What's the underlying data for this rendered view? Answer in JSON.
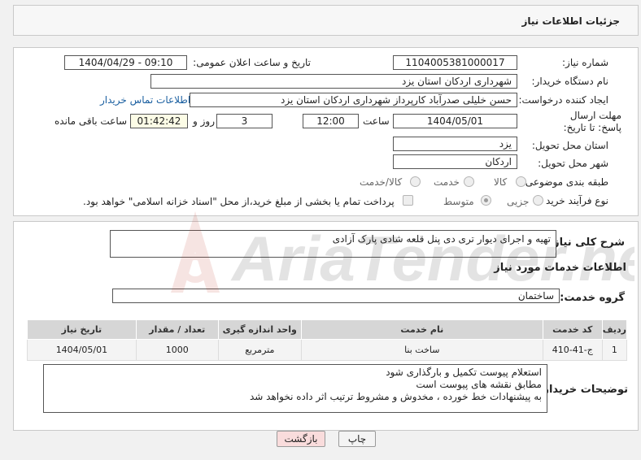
{
  "header": {
    "title": "جزئیات اطلاعات نیاز"
  },
  "form": {
    "need_number_label": "شماره نیاز:",
    "need_number": "1104005381000017",
    "announce_label": "تاریخ و ساعت اعلان عمومی:",
    "announce_value": "1404/04/29 - 09:10",
    "buyer_org_label": "نام دستگاه خریدار:",
    "buyer_org": "شهرداری اردکان استان یزد",
    "creator_label": "ایجاد کننده درخواست:",
    "creator": "حسن خلیلی صدرآباد کارپرداز شهرداری اردکان استان یزد",
    "contact_link": "اطلاعات تماس خریدار",
    "deadline_label": "مهلت ارسال پاسخ: تا تاریخ:",
    "deadline_date": "1404/05/01",
    "time_label": "ساعت",
    "deadline_time": "12:00",
    "days_value": "3",
    "days_label": "روز و",
    "remaining_time": "01:42:42",
    "remaining_label": "ساعت باقی مانده",
    "province_label": "استان محل تحویل:",
    "province": "یزد",
    "city_label": "شهر محل تحویل:",
    "city": "اردکان",
    "category_label": "طبقه بندی موضوعی:",
    "category_options": [
      "کالا",
      "خدمت",
      "کالا/خدمت"
    ],
    "category_selected": "خدمت",
    "process_label": "نوع فرآیند خرید :",
    "process_options": [
      "جزیی",
      "متوسط"
    ],
    "process_selected": "متوسط",
    "payment_note": "پرداخت تمام یا بخشی از مبلغ خرید،از محل \"اسناد خزانه اسلامی\" خواهد بود."
  },
  "summary": {
    "label": "شرح کلی نیاز:",
    "text": "تهیه و اجرای دیوار تری دی پنل قلعه شادی پارک آزادی"
  },
  "services": {
    "title": "اطلاعات خدمات مورد نیاز",
    "group_label": "گروه خدمت:",
    "group_value": "ساختمان",
    "columns": [
      "ردیف",
      "کد خدمت",
      "نام خدمت",
      "واحد اندازه گیری",
      "تعداد / مقدار",
      "تاریخ نیاز"
    ],
    "rows": [
      [
        "1",
        "ج-41-410",
        "ساخت بنا",
        "مترمربع",
        "1000",
        "1404/05/01"
      ]
    ]
  },
  "buyer_notes": {
    "label": "توضیحات خریدار:",
    "lines": [
      "استعلام پیوست تکمیل و بارگذاری شود",
      "مطابق نقشه های پیوست است",
      "به پیشنهادات خط خورده ، مخدوش و مشروط ترتیب اثر داده نخواهد شد"
    ]
  },
  "buttons": {
    "print": "چاپ",
    "back": "بازگشت"
  },
  "watermark": {
    "text": "AriaTender.neT"
  },
  "colors": {
    "link": "#1a5fa0",
    "back_button": "#f9dcdc",
    "header_bg": "#d6d6d6"
  }
}
